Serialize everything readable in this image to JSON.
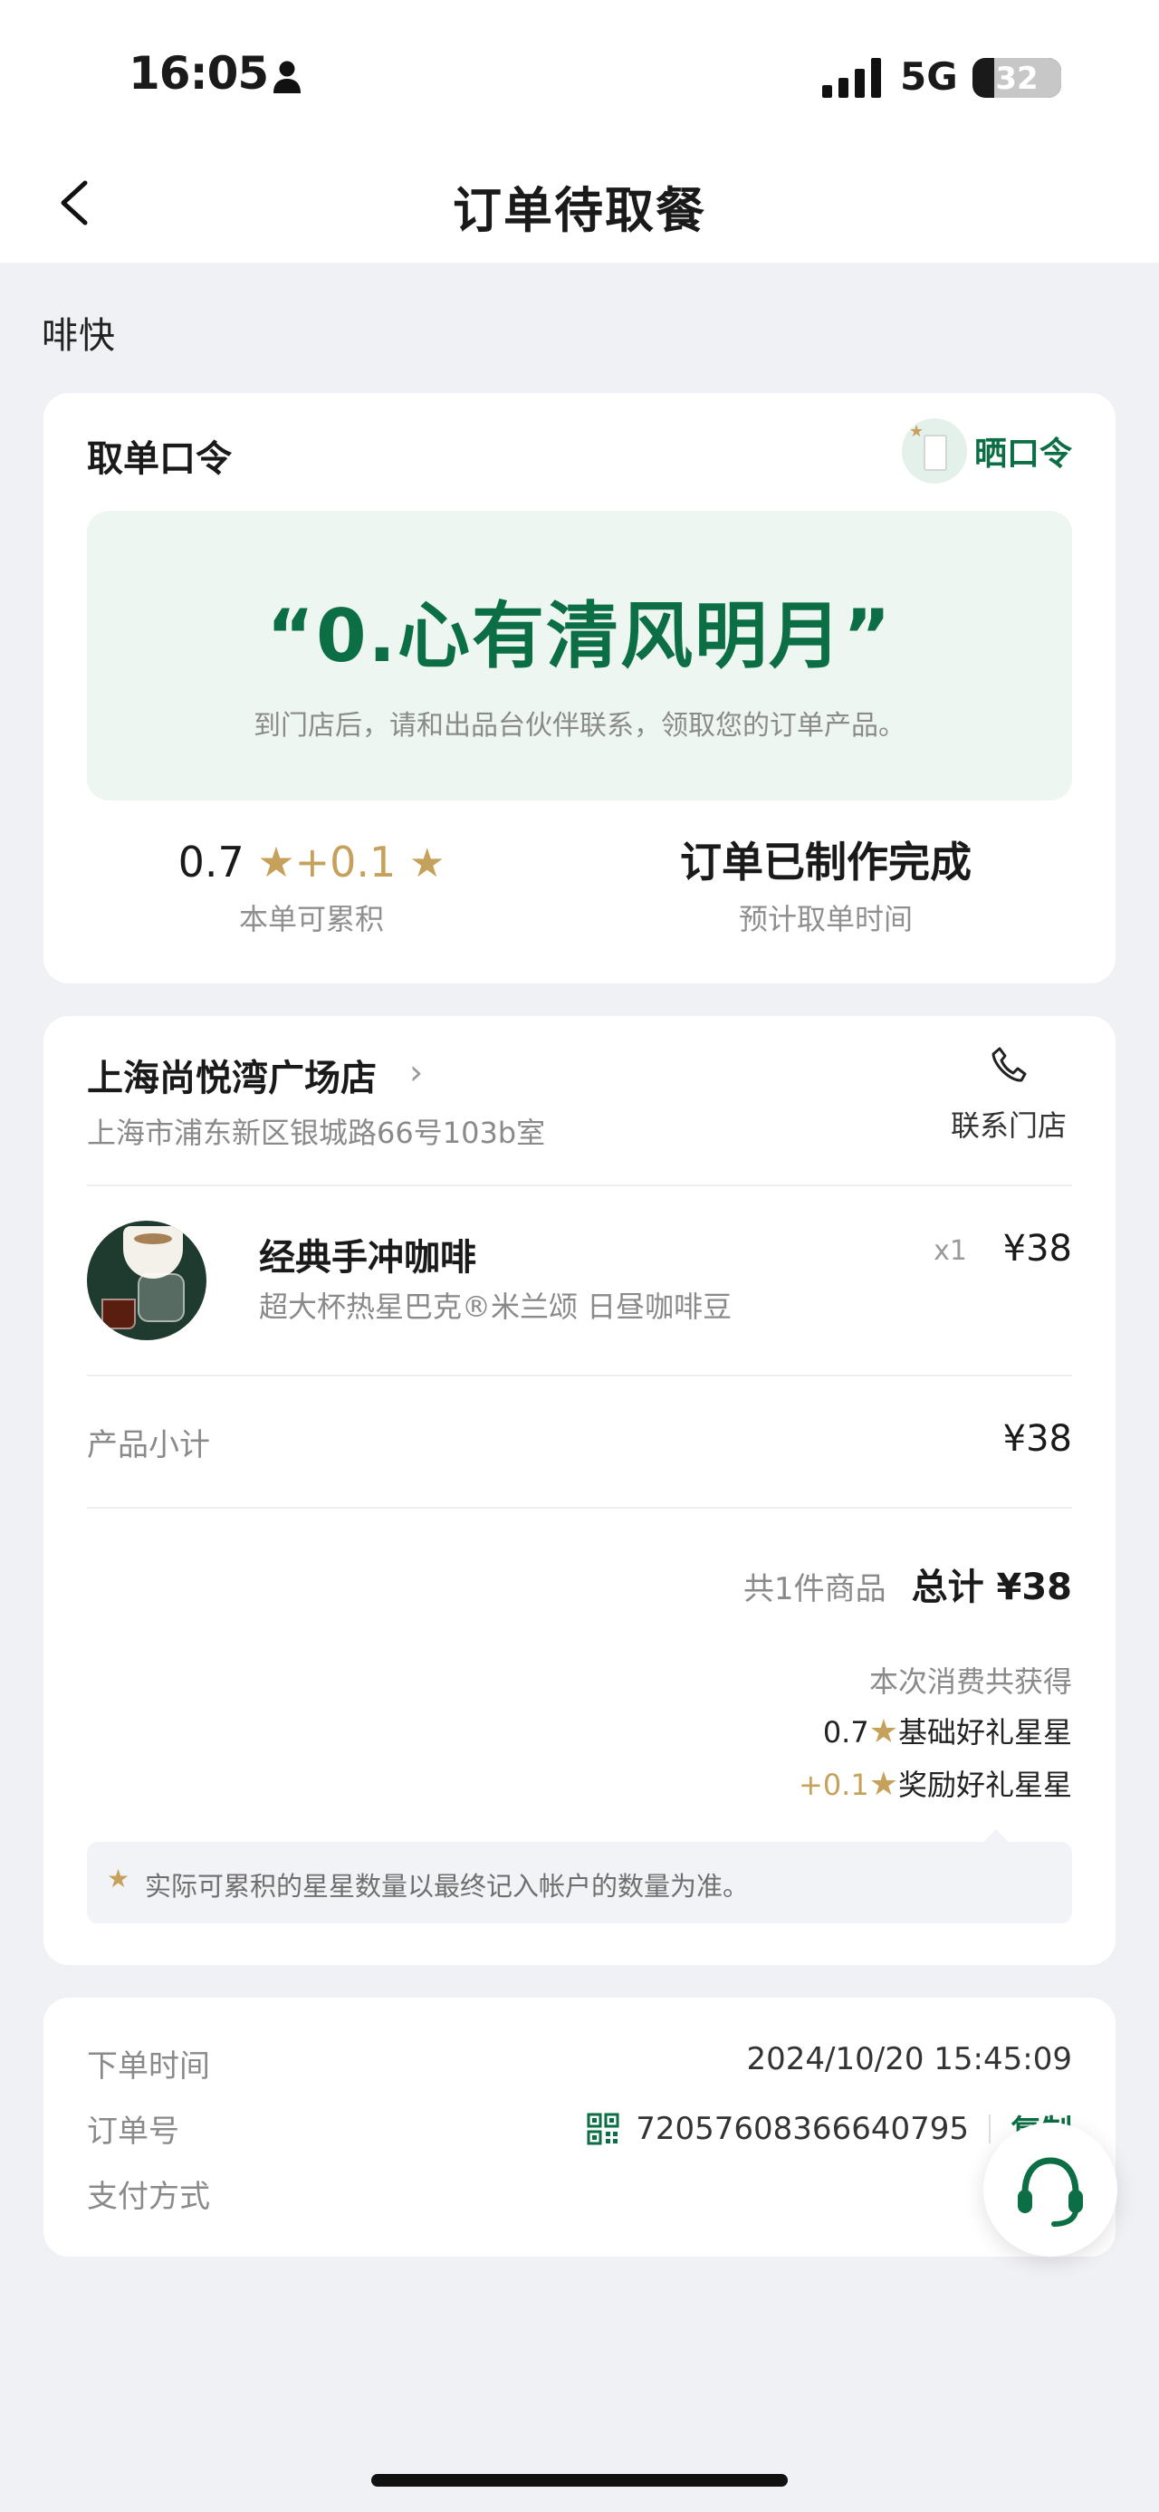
{
  "status_bar": {
    "time": "16:05",
    "network": "5G",
    "battery": "32"
  },
  "nav": {
    "title": "订单待取餐"
  },
  "brand": "啡快",
  "pickup": {
    "title": "取单口令",
    "share_label": "晒口令",
    "code": "“0.心有清风明月”",
    "hint": "到门店后，请和出品台伙伴联系，领取您的订单产品。",
    "stars_base": "0.7",
    "stars_bonus": "+0.1",
    "stars_label": "本单可累积",
    "status": "订单已制作完成",
    "status_label": "预计取单时间"
  },
  "store": {
    "name": "上海尚悦湾广场店",
    "address": "上海市浦东新区银城路66号103b室",
    "contact_label": "联系门店"
  },
  "product": {
    "name": "经典手冲咖啡",
    "desc": "超大杯热星巴克®米兰颂 日昼咖啡豆",
    "qty": "x1",
    "price": "¥38"
  },
  "summary": {
    "subtotal_label": "产品小计",
    "subtotal": "¥38",
    "count": "共1件商品",
    "total": "总计 ¥38",
    "earn_title": "本次消费共获得",
    "earn_base_value": "0.7",
    "earn_base_label": "基础好礼星星",
    "earn_bonus_value": "+0.1",
    "earn_bonus_label": "奖励好礼星星",
    "note": "实际可累积的星星数量以最终记入帐户的数量为准。"
  },
  "order_info": {
    "time_label": "下单时间",
    "time": "2024/10/20 15:45:09",
    "number_label": "订单号",
    "number": "72057608366640795",
    "copy_label": "复制",
    "payment_label": "支付方式"
  },
  "colors": {
    "brand_green": "#0b6e45",
    "star_gold": "#c6a15b",
    "background": "#f0f1f5"
  }
}
